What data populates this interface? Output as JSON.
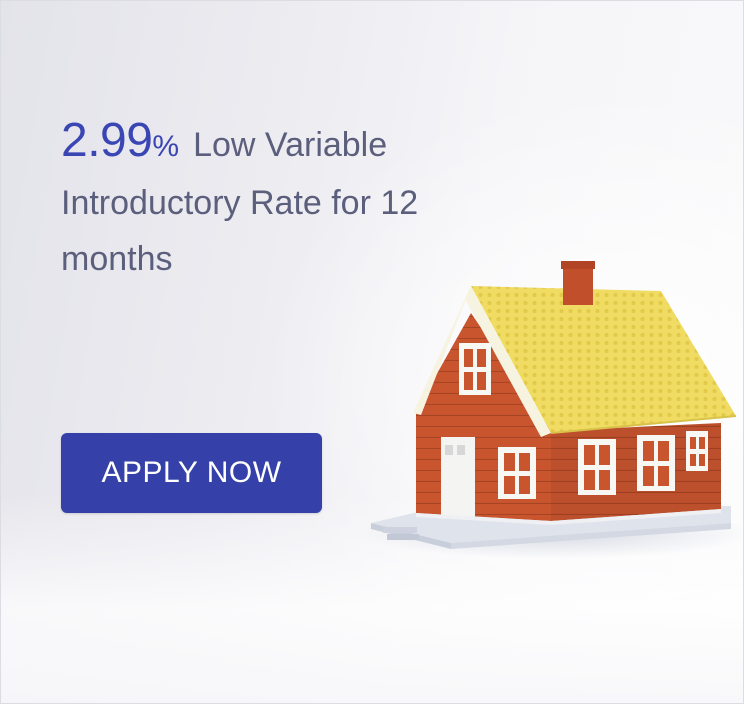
{
  "promo": {
    "rate_value": "2.99",
    "rate_unit": "%",
    "description": "Low Variable Introductory Rate for 12 months"
  },
  "cta": {
    "label": "APPLY NOW"
  },
  "image": {
    "icon": "house-illustration"
  },
  "colors": {
    "accent": "#3a46b3",
    "button": "#3541a8",
    "text": "#5b5f7c"
  }
}
